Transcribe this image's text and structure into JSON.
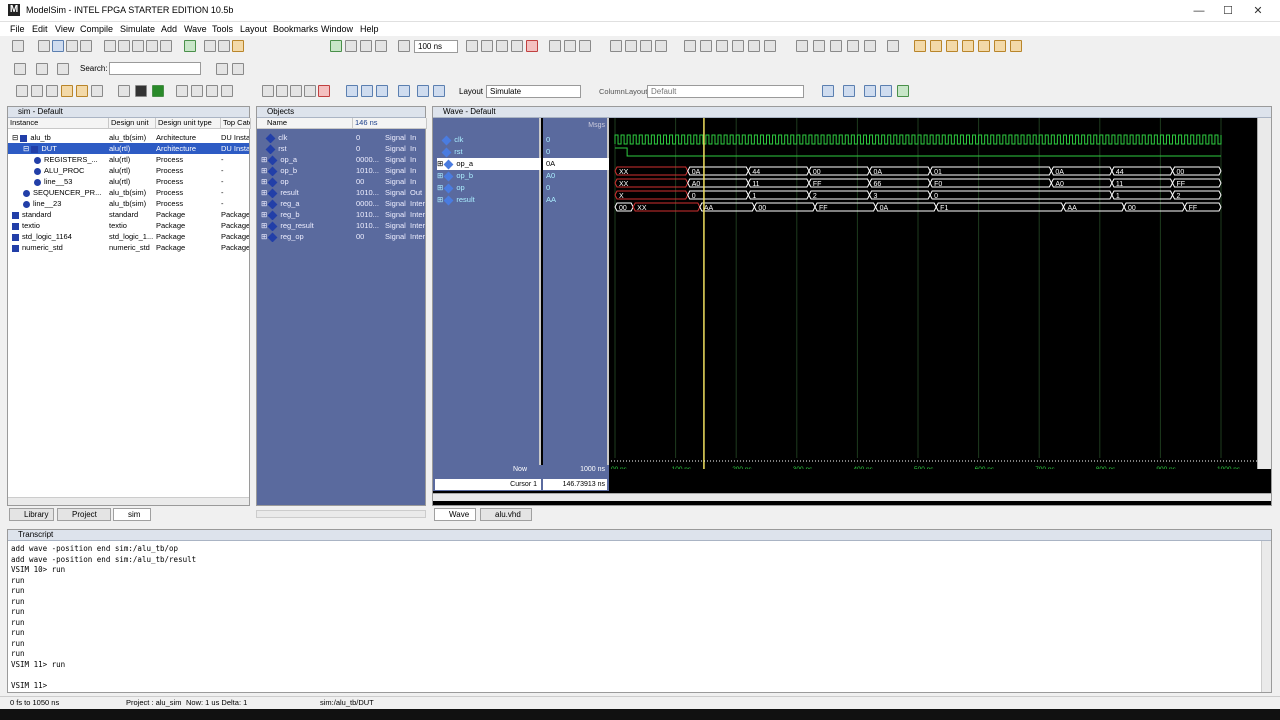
{
  "window": {
    "title": "ModelSim - INTEL FPGA STARTER EDITION 10.5b",
    "app_icon": "M",
    "minimize": "—",
    "maximize": "☐",
    "close": "✕"
  },
  "menu": [
    "File",
    "Edit",
    "View",
    "Compile",
    "Simulate",
    "Add",
    "Wave",
    "Tools",
    "Layout",
    "Bookmarks",
    "Window",
    "Help"
  ],
  "toolbar": {
    "run_length": "100 ns",
    "search_label": "Search:",
    "search_value": "",
    "layout_label": "Layout",
    "layout_value": "Simulate",
    "column_layout_label": "ColumnLayout",
    "column_layout_value": "Default"
  },
  "sim_pane": {
    "title": "sim - Default",
    "columns": [
      "Instance",
      "Design unit",
      "Design unit type",
      "Top Cate"
    ],
    "rows": [
      {
        "name": "alu_tb",
        "unit": "alu_tb(sim)",
        "type": "Architecture",
        "cat": "DU Insta",
        "indent": 0,
        "exp": "-",
        "icon": "box"
      },
      {
        "name": "DUT",
        "unit": "alu(rtl)",
        "type": "Architecture",
        "cat": "DU Insta",
        "indent": 1,
        "exp": "-",
        "icon": "box",
        "selected": true
      },
      {
        "name": "REGISTERS_...",
        "unit": "alu(rtl)",
        "type": "Process",
        "cat": "-",
        "indent": 2,
        "exp": "",
        "icon": "dot"
      },
      {
        "name": "ALU_PROC",
        "unit": "alu(rtl)",
        "type": "Process",
        "cat": "-",
        "indent": 2,
        "exp": "",
        "icon": "dot"
      },
      {
        "name": "line__53",
        "unit": "alu(rtl)",
        "type": "Process",
        "cat": "-",
        "indent": 2,
        "exp": "",
        "icon": "dot"
      },
      {
        "name": "SEQUENCER_PR...",
        "unit": "alu_tb(sim)",
        "type": "Process",
        "cat": "-",
        "indent": 1,
        "exp": "",
        "icon": "dot"
      },
      {
        "name": "line__23",
        "unit": "alu_tb(sim)",
        "type": "Process",
        "cat": "-",
        "indent": 1,
        "exp": "",
        "icon": "dot"
      },
      {
        "name": "standard",
        "unit": "standard",
        "type": "Package",
        "cat": "Package",
        "indent": 0,
        "exp": "",
        "icon": "box"
      },
      {
        "name": "textio",
        "unit": "textio",
        "type": "Package",
        "cat": "Package",
        "indent": 0,
        "exp": "",
        "icon": "box"
      },
      {
        "name": "std_logic_1164",
        "unit": "std_logic_1...",
        "type": "Package",
        "cat": "Package",
        "indent": 0,
        "exp": "",
        "icon": "box"
      },
      {
        "name": "numeric_std",
        "unit": "numeric_std",
        "type": "Package",
        "cat": "Package",
        "indent": 0,
        "exp": "",
        "icon": "box"
      }
    ],
    "tabs": [
      "Library",
      "Project",
      "sim"
    ]
  },
  "objects_pane": {
    "title": "Objects",
    "columns": [
      "Name",
      "146 ns"
    ],
    "rows": [
      {
        "name": "clk",
        "value": "0",
        "kind": "Signal",
        "mode": "In",
        "exp": false
      },
      {
        "name": "rst",
        "value": "0",
        "kind": "Signal",
        "mode": "In",
        "exp": false
      },
      {
        "name": "op_a",
        "value": "0000...",
        "kind": "Signal",
        "mode": "In",
        "exp": true
      },
      {
        "name": "op_b",
        "value": "1010...",
        "kind": "Signal",
        "mode": "In",
        "exp": true
      },
      {
        "name": "op",
        "value": "00",
        "kind": "Signal",
        "mode": "In",
        "exp": true
      },
      {
        "name": "result",
        "value": "1010...",
        "kind": "Signal",
        "mode": "Out",
        "exp": true
      },
      {
        "name": "reg_a",
        "value": "0000...",
        "kind": "Signal",
        "mode": "Inter",
        "exp": true
      },
      {
        "name": "reg_b",
        "value": "1010...",
        "kind": "Signal",
        "mode": "Inter",
        "exp": true
      },
      {
        "name": "reg_result",
        "value": "1010...",
        "kind": "Signal",
        "mode": "Inter",
        "exp": true
      },
      {
        "name": "reg_op",
        "value": "00",
        "kind": "Signal",
        "mode": "Inter",
        "exp": true
      }
    ]
  },
  "wave_pane": {
    "title": "Wave - Default",
    "msgs_label": "Msgs",
    "signals": [
      {
        "name": "clk",
        "msg": "0",
        "exp": false
      },
      {
        "name": "rst",
        "msg": "0",
        "exp": false
      },
      {
        "name": "op_a",
        "msg": "0A",
        "exp": true,
        "selected": true
      },
      {
        "name": "op_b",
        "msg": "A0",
        "exp": true
      },
      {
        "name": "op",
        "msg": "0",
        "exp": true
      },
      {
        "name": "result",
        "msg": "AA",
        "exp": true
      }
    ],
    "op_a_values": [
      "XX",
      "0A",
      "44",
      "00",
      "0A",
      "01",
      "0A",
      "44",
      "00"
    ],
    "op_b_values": [
      "XX",
      "A0",
      "11",
      "FF",
      "66",
      "F0",
      "A0",
      "11",
      "FF"
    ],
    "op_values": [
      "X",
      "0",
      "1",
      "2",
      "3",
      "0",
      "1",
      "2"
    ],
    "result_values": [
      "00",
      "XX",
      "AA",
      "00",
      "FF",
      "0A",
      "F1",
      "AA",
      "00",
      "FF"
    ],
    "now_label": "Now",
    "now_value": "1000 ns",
    "cursor_label": "Cursor 1",
    "cursor_value": "146.73913 ns",
    "cursor_flag": "146.73913 ns",
    "time_ticks": [
      "00 ns",
      "100 ns",
      "200 ns",
      "300 ns",
      "400 ns",
      "500 ns",
      "600 ns",
      "700 ns",
      "800 ns",
      "900 ns",
      "1000 ns"
    ],
    "tabs": [
      "Wave",
      "alu.vhd"
    ]
  },
  "transcript": {
    "title": "Transcript",
    "lines": [
      "add wave -position end  sim:/alu_tb/op",
      "add wave -position end  sim:/alu_tb/result",
      "VSIM 10> run",
      "run",
      "run",
      "run",
      "run",
      "run",
      "run",
      "run",
      "run",
      "VSIM 11> run",
      "",
      "VSIM 11>"
    ]
  },
  "statusbar": {
    "range": "0 fs to 1050 ns",
    "project": "Project : alu_sim",
    "now": "Now: 1 us  Delta: 1",
    "context": "sim:/alu_tb/DUT"
  },
  "colors": {
    "wave_green": "#2ecc40",
    "cursor": "#f0e060",
    "panel_blue": "#5a6a9e",
    "bus_white": "#ffffff"
  }
}
